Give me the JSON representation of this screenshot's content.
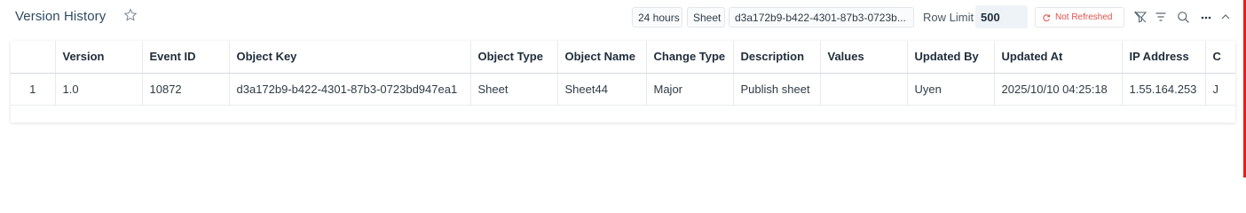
{
  "panel": {
    "title": "Version History"
  },
  "filters": {
    "period": "24 hours",
    "object_type": "Sheet",
    "object_key": "d3a172b9-b422-4301-87b3-0723b..."
  },
  "row_limit": {
    "label": "Row Limit",
    "value": "500"
  },
  "refresh_status": {
    "label": "Not Refreshed",
    "color": "#e0504a"
  },
  "icons": [
    "star-icon",
    "filter-off-icon",
    "sort-lines-icon",
    "search-icon",
    "more-icon",
    "collapse-chevron-icon",
    "refresh-icon"
  ],
  "table": {
    "columns": [
      "",
      "Version",
      "Event ID",
      "Object Key",
      "Object Type",
      "Object Name",
      "Change Type",
      "Description",
      "Values",
      "Updated By",
      "Updated At",
      "IP Address",
      "C"
    ],
    "rows": [
      [
        "1",
        "1.0",
        "10872",
        "d3a172b9-b422-4301-87b3-0723bd947ea1",
        "Sheet",
        "Sheet44",
        "Major",
        "Publish sheet",
        "",
        "Uyen",
        "2025/10/10 04:25:18",
        "1.55.164.253",
        "J"
      ]
    ]
  },
  "colors": {
    "title": "#2f4a63",
    "accent_red": "#e02020",
    "row_limit_bg": "#eef3f8"
  }
}
